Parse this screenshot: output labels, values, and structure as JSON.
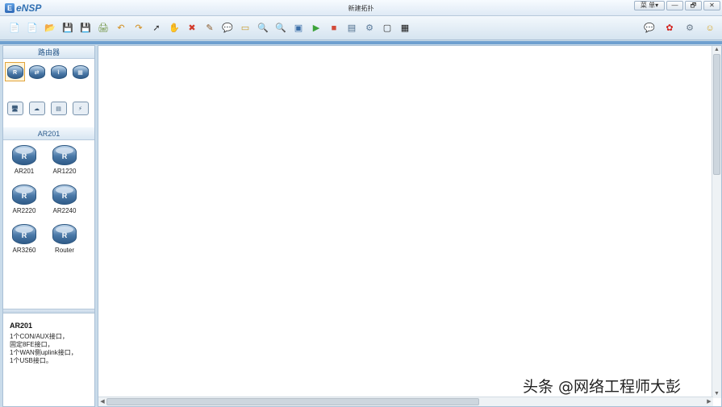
{
  "app": {
    "name": "eNSP",
    "window_title": "新建拓扑"
  },
  "window_controls": {
    "menu": "菜 单▾",
    "minimize": "—",
    "restore": "🗗",
    "close": "✕"
  },
  "toolbar": {
    "left": [
      {
        "name": "new-topology-icon",
        "glyph": "📄",
        "color": "#4a9a3a"
      },
      {
        "name": "new-example-icon",
        "glyph": "📄",
        "color": "#4a9a3a"
      },
      {
        "name": "open-icon",
        "glyph": "📂",
        "color": "#d29a2a"
      },
      {
        "name": "save-icon",
        "glyph": "💾",
        "color": "#3a6ea8"
      },
      {
        "name": "save-as-icon",
        "glyph": "💾",
        "color": "#3a6ea8"
      },
      {
        "name": "print-icon",
        "glyph": "🖨",
        "color": "#6b8f3a"
      },
      {
        "name": "undo-icon",
        "glyph": "↶",
        "color": "#d18a16"
      },
      {
        "name": "redo-icon",
        "glyph": "↷",
        "color": "#d18a16"
      },
      {
        "name": "select-icon",
        "glyph": "➚",
        "color": "#333333"
      },
      {
        "name": "hand-icon",
        "glyph": "✋",
        "color": "#c97e28"
      },
      {
        "name": "delete-icon",
        "glyph": "✖",
        "color": "#d23a2a"
      },
      {
        "name": "delete-links-icon",
        "glyph": "✎",
        "color": "#8a5a2a"
      },
      {
        "name": "text-icon",
        "glyph": "💬",
        "color": "#6d8aa8"
      },
      {
        "name": "palette-icon",
        "glyph": "▭",
        "color": "#c79a2a"
      },
      {
        "name": "zoom-in-icon",
        "glyph": "🔍",
        "color": "#4a8a3a"
      },
      {
        "name": "zoom-out-icon",
        "glyph": "🔍",
        "color": "#4a8a3a"
      },
      {
        "name": "fit-icon",
        "glyph": "▣",
        "color": "#3a6ea8"
      },
      {
        "name": "start-icon",
        "glyph": "▶",
        "color": "#3ca33a"
      },
      {
        "name": "stop-icon",
        "glyph": "■",
        "color": "#d24a3a"
      },
      {
        "name": "capture-icon",
        "glyph": "▤",
        "color": "#4a6a8a"
      },
      {
        "name": "topology-icon",
        "glyph": "⚙",
        "color": "#5a7a9a"
      },
      {
        "name": "grid-icon",
        "glyph": "▢",
        "color": "#333333"
      },
      {
        "name": "console-icon",
        "glyph": "▦",
        "color": "#111111"
      }
    ],
    "right": [
      {
        "name": "chat-icon",
        "glyph": "💬",
        "color": "#5a7a9a"
      },
      {
        "name": "huawei-icon",
        "glyph": "✿",
        "color": "#d2231e"
      },
      {
        "name": "settings-icon",
        "glyph": "⚙",
        "color": "#6a7a8a"
      },
      {
        "name": "help-icon",
        "glyph": "☺",
        "color": "#d8a21c"
      }
    ]
  },
  "left_panel": {
    "category_header": "路由器",
    "categories": [
      {
        "name": "router-category-icon",
        "glyph": "R",
        "selected": true
      },
      {
        "name": "switch-category-icon",
        "glyph": "⇄"
      },
      {
        "name": "wlan-category-icon",
        "glyph": "⌇"
      },
      {
        "name": "firewall-category-icon",
        "glyph": "▦"
      },
      {
        "name": "terminal-category-icon",
        "glyph": "🖥"
      },
      {
        "name": "cloud-category-icon",
        "glyph": "☁"
      },
      {
        "name": "other-device-category-icon",
        "glyph": "▤"
      },
      {
        "name": "connection-category-icon",
        "glyph": "⚡"
      }
    ],
    "device_header": "AR201",
    "devices": [
      "AR201",
      "AR1220",
      "AR2220",
      "AR2240",
      "AR3260",
      "Router"
    ],
    "device_glyph": "R"
  },
  "info": {
    "title": "AR201",
    "lines": [
      "1个CON/AUX接口，",
      "固定8FE接口，",
      "1个WAN侧uplink接口，",
      "1个USB接口。"
    ]
  },
  "scrollbars": {
    "up": "▲",
    "down": "▼",
    "left": "◀",
    "right": "▶"
  },
  "watermark": "头条 @网络工程师大彭"
}
